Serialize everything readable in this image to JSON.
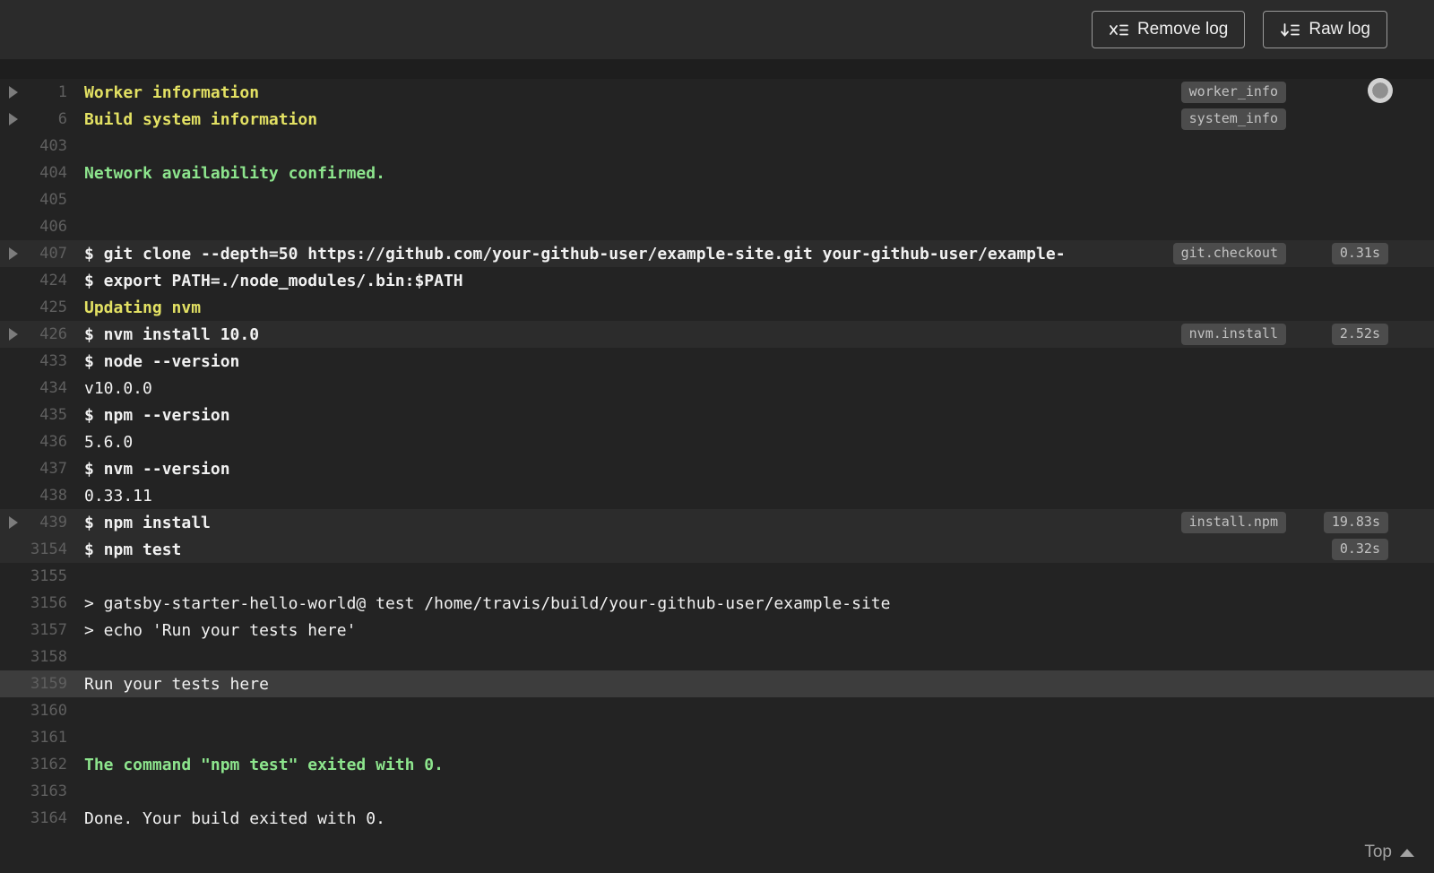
{
  "toolbar": {
    "remove_log": "Remove log",
    "raw_log": "Raw log"
  },
  "footer": {
    "top": "Top"
  },
  "colors": {
    "background": "#232323",
    "toolbar_background": "#2b2b2b",
    "gap_background": "#1e1e1e",
    "text": "#f1f1f1",
    "line_number": "#5f5f5f",
    "fold_title": "#e3e163",
    "success": "#8de58d",
    "badge_background": "#4c4c4c",
    "badge_text": "#c2c2c2",
    "row_highlight": "#2c2c2c",
    "selected_row": "#3d3d3d"
  },
  "log": {
    "lines": [
      {
        "number": "1",
        "text": "Worker information",
        "style": "fold-title",
        "fold": true,
        "badge": "worker_info"
      },
      {
        "number": "6",
        "text": "Build system information",
        "style": "fold-title",
        "fold": true,
        "badge": "system_info"
      },
      {
        "number": "403",
        "text": ""
      },
      {
        "number": "404",
        "text": "Network availability confirmed.",
        "style": "success"
      },
      {
        "number": "405",
        "text": ""
      },
      {
        "number": "406",
        "text": ""
      },
      {
        "number": "407",
        "text": "$ git clone --depth=50 https://github.com/your-github-user/example-site.git your-github-user/example-",
        "style": "command",
        "fold": true,
        "badge": "git.checkout",
        "time": "0.31s",
        "highlight": "row"
      },
      {
        "number": "424",
        "text": "$ export PATH=./node_modules/.bin:$PATH",
        "style": "command"
      },
      {
        "number": "425",
        "text": "Updating nvm",
        "style": "fold-title"
      },
      {
        "number": "426",
        "text": "$ nvm install 10.0",
        "style": "command",
        "fold": true,
        "badge": "nvm.install",
        "time": "2.52s",
        "highlight": "row"
      },
      {
        "number": "433",
        "text": "$ node --version",
        "style": "command"
      },
      {
        "number": "434",
        "text": "v10.0.0"
      },
      {
        "number": "435",
        "text": "$ npm --version",
        "style": "command"
      },
      {
        "number": "436",
        "text": "5.6.0"
      },
      {
        "number": "437",
        "text": "$ nvm --version",
        "style": "command"
      },
      {
        "number": "438",
        "text": "0.33.11"
      },
      {
        "number": "439",
        "text": "$ npm install",
        "style": "command",
        "fold": true,
        "badge": "install.npm",
        "time": "19.83s",
        "highlight": "row"
      },
      {
        "number": "3154",
        "text": "$ npm test",
        "style": "command",
        "time": "0.32s",
        "highlight": "row"
      },
      {
        "number": "3155",
        "text": ""
      },
      {
        "number": "3156",
        "text": "> gatsby-starter-hello-world@ test /home/travis/build/your-github-user/example-site"
      },
      {
        "number": "3157",
        "text": "> echo 'Run your tests here'"
      },
      {
        "number": "3158",
        "text": ""
      },
      {
        "number": "3159",
        "text": "Run your tests here",
        "highlight": "selected"
      },
      {
        "number": "3160",
        "text": ""
      },
      {
        "number": "3161",
        "text": ""
      },
      {
        "number": "3162",
        "text": "The command \"npm test\" exited with 0.",
        "style": "success"
      },
      {
        "number": "3163",
        "text": ""
      },
      {
        "number": "3164",
        "text": "Done. Your build exited with 0."
      }
    ]
  }
}
